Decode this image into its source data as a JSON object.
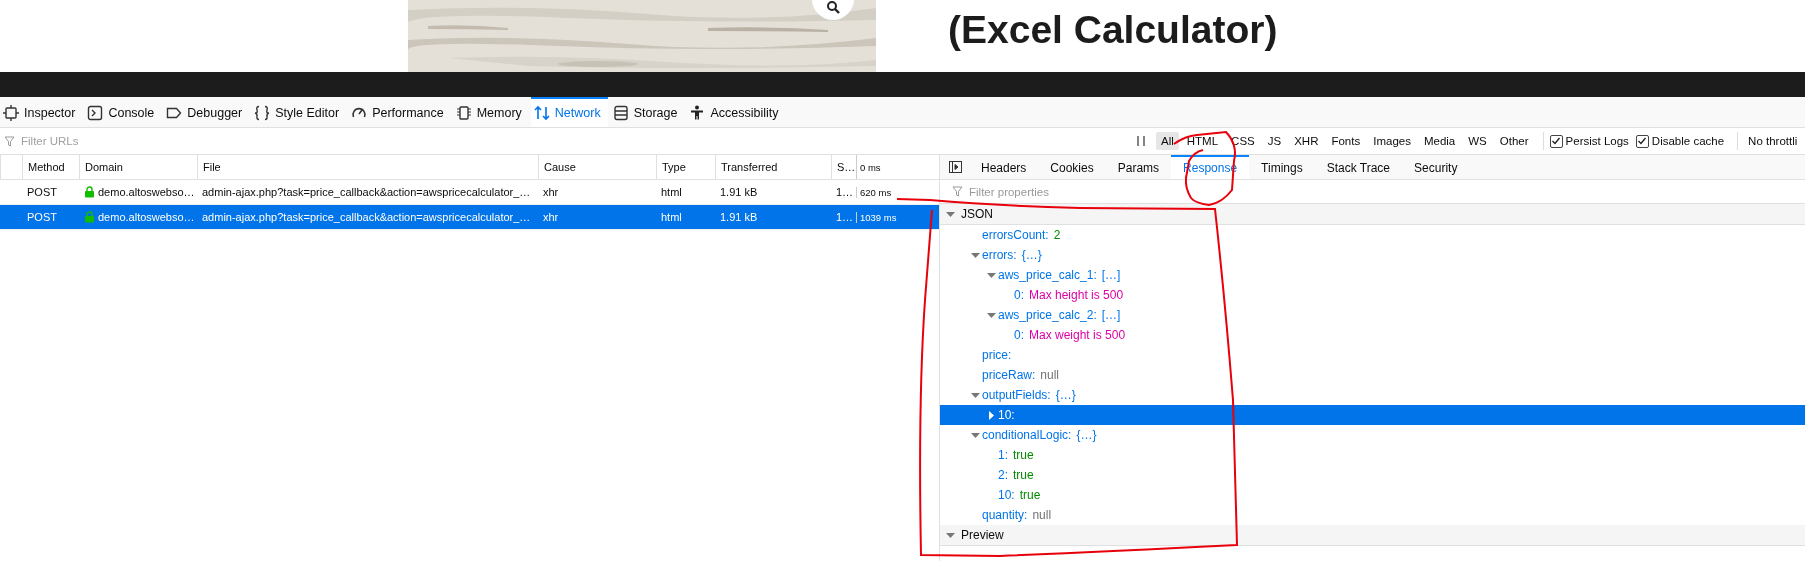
{
  "page": {
    "heading": "(Excel Calculator)"
  },
  "devtools_tabs": [
    {
      "label": "Inspector",
      "selected": false
    },
    {
      "label": "Console",
      "selected": false
    },
    {
      "label": "Debugger",
      "selected": false
    },
    {
      "label": "Style Editor",
      "selected": false
    },
    {
      "label": "Performance",
      "selected": false
    },
    {
      "label": "Memory",
      "selected": false
    },
    {
      "label": "Network",
      "selected": true
    },
    {
      "label": "Storage",
      "selected": false
    },
    {
      "label": "Accessibility",
      "selected": false
    }
  ],
  "url_filter": {
    "placeholder": "Filter URLs"
  },
  "type_filters": [
    {
      "label": "All",
      "selected": true
    },
    {
      "label": "HTML",
      "selected": false
    },
    {
      "label": "CSS",
      "selected": false
    },
    {
      "label": "JS",
      "selected": false
    },
    {
      "label": "XHR",
      "selected": false
    },
    {
      "label": "Fonts",
      "selected": false
    },
    {
      "label": "Images",
      "selected": false
    },
    {
      "label": "Media",
      "selected": false
    },
    {
      "label": "WS",
      "selected": false
    },
    {
      "label": "Other",
      "selected": false
    }
  ],
  "options": [
    {
      "label": "Persist Logs",
      "checked": true
    },
    {
      "label": "Disable cache",
      "checked": true
    }
  ],
  "throttling": "No throttli",
  "requests": {
    "columns": [
      "Method",
      "Domain",
      "File",
      "Cause",
      "Type",
      "Transferred",
      "S…",
      "0 ms"
    ],
    "rows": [
      {
        "method": "POST",
        "domain": "demo.altoswebso…",
        "file": "admin-ajax.php?task=price_callback&action=awspricecalculator_…",
        "cause": "xhr",
        "type": "html",
        "transferred": "1.91 kB",
        "size": "1…",
        "timing": "620 ms",
        "selected": false
      },
      {
        "method": "POST",
        "domain": "demo.altoswebso…",
        "file": "admin-ajax.php?task=price_callback&action=awspricecalculator_…",
        "cause": "xhr",
        "type": "html",
        "transferred": "1.91 kB",
        "size": "1…",
        "timing": "1039 ms",
        "selected": true
      }
    ]
  },
  "details": {
    "tabs": [
      {
        "label": "Headers",
        "selected": false
      },
      {
        "label": "Cookies",
        "selected": false
      },
      {
        "label": "Params",
        "selected": false
      },
      {
        "label": "Response",
        "selected": true
      },
      {
        "label": "Timings",
        "selected": false
      },
      {
        "label": "Stack Trace",
        "selected": false
      },
      {
        "label": "Security",
        "selected": false
      }
    ],
    "filter": {
      "placeholder": "Filter properties"
    },
    "sections": [
      {
        "title": "JSON",
        "expanded": true,
        "tree": [
          {
            "key": "errorsCount:",
            "value": "2",
            "kind": "number",
            "selected": false
          },
          {
            "key": "errors:",
            "value": "{…}",
            "kind": "object",
            "expanded": true,
            "selected": false,
            "children": [
              {
                "key": "aws_price_calc_1:",
                "value": "[…]",
                "kind": "object",
                "expanded": true,
                "selected": false,
                "children": [
                  {
                    "key": "0:",
                    "value": "Max height is 500",
                    "kind": "string",
                    "selected": false
                  }
                ]
              },
              {
                "key": "aws_price_calc_2:",
                "value": "[…]",
                "kind": "object",
                "expanded": true,
                "selected": false,
                "children": [
                  {
                    "key": "0:",
                    "value": "Max weight is 500",
                    "kind": "string",
                    "selected": false
                  }
                ]
              }
            ]
          },
          {
            "key": "price:",
            "selected": false
          },
          {
            "key": "priceRaw:",
            "value": "null",
            "kind": "null",
            "selected": false
          },
          {
            "key": "outputFields:",
            "value": "{…}",
            "kind": "object",
            "expanded": true,
            "selected": false,
            "children": [
              {
                "key": "10:",
                "expanded": false,
                "selected": true
              }
            ]
          },
          {
            "key": "conditionalLogic:",
            "value": "{…}",
            "kind": "object",
            "expanded": true,
            "selected": false,
            "children": [
              {
                "key": "1:",
                "value": "true",
                "kind": "boolean",
                "selected": false
              },
              {
                "key": "2:",
                "value": "true",
                "kind": "boolean",
                "selected": false
              },
              {
                "key": "10:",
                "value": "true",
                "kind": "boolean",
                "selected": false
              }
            ]
          },
          {
            "key": "quantity:",
            "value": "null",
            "kind": "null",
            "selected": false
          }
        ]
      },
      {
        "title": "Preview",
        "expanded": true
      }
    ]
  },
  "annotations": {
    "response_tab_circled": true,
    "json_outlined": true
  }
}
